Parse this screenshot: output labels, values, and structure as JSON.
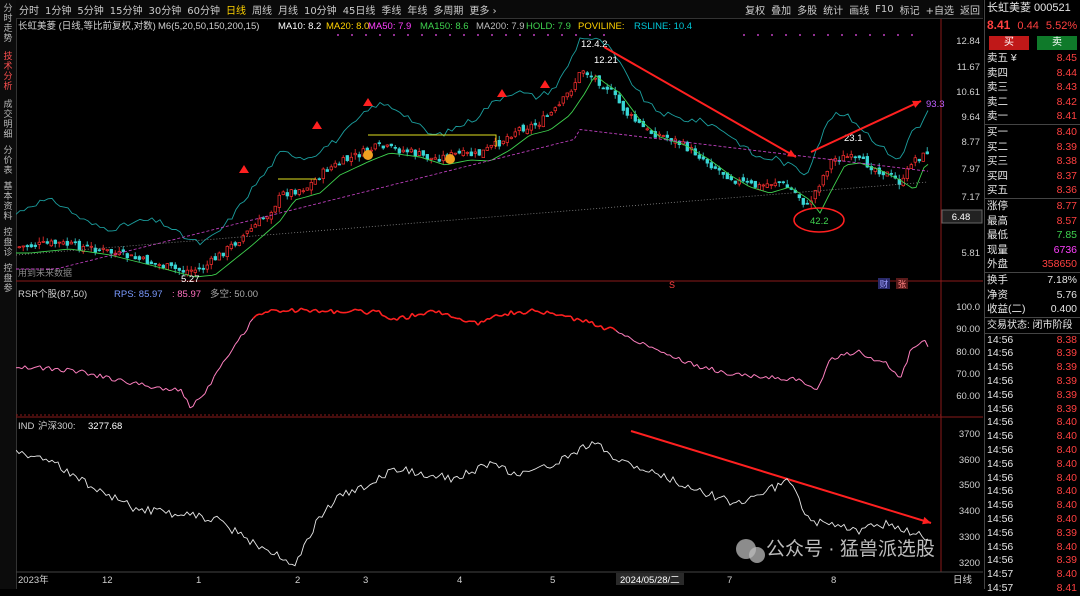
{
  "left_tabs": [
    {
      "label": "分时走势",
      "active": false
    },
    {
      "label": "技术分析",
      "active": true
    },
    {
      "label": "成交明细",
      "active": false
    },
    {
      "label": "分价表",
      "active": false
    },
    {
      "label": "基本资料",
      "active": false
    },
    {
      "label": "控盘诊",
      "active": false
    },
    {
      "label": "控盘参",
      "active": false
    }
  ],
  "toolbar": {
    "periods": [
      "分时",
      "1分钟",
      "5分钟",
      "15分钟",
      "30分钟",
      "60分钟",
      "日线",
      "周线",
      "月线",
      "10分钟",
      "45日线",
      "季线",
      "年线",
      "多周期",
      "更多 ›"
    ],
    "active_period": "日线",
    "actions": [
      "复权",
      "叠加",
      "多股",
      "统计",
      "画线",
      "F10",
      "标记",
      "+自选",
      "返回"
    ]
  },
  "main": {
    "header": "长虹美菱 (日线,等比前复权,对数)",
    "ma_label": "M6(5,20,50,150,200,15)",
    "ma_items": [
      {
        "text": "MA10: 8.2",
        "color": "#ffffff"
      },
      {
        "text": "MA20: 8.0",
        "color": "#ffd200"
      },
      {
        "text": "MA50: 7.9",
        "color": "#ff40ff"
      },
      {
        "text": "MA150: 8.6",
        "color": "#3fd24f"
      },
      {
        "text": "MA200: 7.9",
        "color": "#bbbbbb"
      },
      {
        "text": "HOLD: 7.9",
        "color": "#3fd24f"
      },
      {
        "text": "POVILINE:",
        "color": "#ffd200"
      },
      {
        "text": "RSLINE: 10.4",
        "color": "#00c8d8"
      }
    ],
    "y_ticks": [
      "12.84",
      "11.67",
      "10.61",
      "9.64",
      "8.77",
      "7.97",
      "7.17",
      "6.48",
      "5.81"
    ],
    "current_price_tag": "6.48",
    "note": "用到未来数据",
    "annotations": {
      "low": "5.27",
      "peak": "12.4.2",
      "peak2": "12.21",
      "mid": "23.1",
      "circle": "42.2",
      "arrow_end": "93.3"
    },
    "tags": [
      "S",
      "财",
      "张"
    ]
  },
  "rsr": {
    "header": "RSR个股(87,50)",
    "rps_text": "RPS: 85.97",
    "val_text": ": 85.97",
    "ls_text": "多空: 50.00",
    "y_ticks": [
      "100.0",
      "90.00",
      "80.00",
      "70.00",
      "60.00"
    ]
  },
  "ind": {
    "header": "IND",
    "name": "沪深300:",
    "value": "3277.68",
    "y_ticks": [
      "3700",
      "3600",
      "3500",
      "3400",
      "3300",
      "3200"
    ]
  },
  "x_axis": {
    "labels": [
      "2023年",
      "12",
      "1",
      "2",
      "3",
      "4",
      "5",
      "2024/05/28/二",
      "7",
      "8"
    ],
    "right_label": "日线"
  },
  "watermark": "公众号 · 猛兽派选股",
  "right_panel": {
    "title": "长虹美菱 000521",
    "price": "8.41",
    "change": "0.44",
    "pct": "5.52%",
    "buy_btn": "买",
    "sell_btn": "卖",
    "asks": [
      {
        "label": "卖五 ¥",
        "price": "8.45",
        "vol": ""
      },
      {
        "label": "卖四",
        "price": "8.44",
        "vol": ""
      },
      {
        "label": "卖三",
        "price": "8.43",
        "vol": ""
      },
      {
        "label": "卖二",
        "price": "8.42",
        "vol": ""
      },
      {
        "label": "卖一",
        "price": "8.41",
        "vol": ""
      }
    ],
    "bids": [
      {
        "label": "买一",
        "price": "8.40"
      },
      {
        "label": "买二",
        "price": "8.39"
      },
      {
        "label": "买三",
        "price": "8.38"
      },
      {
        "label": "买四",
        "price": "8.37"
      },
      {
        "label": "买五",
        "price": "8.36"
      }
    ],
    "stats": [
      {
        "label": "涨停",
        "value": "8.77",
        "color": "#ff4040"
      },
      {
        "label": "最高",
        "value": "8.57",
        "color": "#ff4040"
      },
      {
        "label": "最低",
        "value": "7.85",
        "color": "#3fd24f"
      },
      {
        "label": "现量",
        "value": "6736",
        "color": "#ff40ff"
      },
      {
        "label": "外盘",
        "value": "358650",
        "color": "#ff4040"
      }
    ],
    "stats2": [
      {
        "label": "换手",
        "value": "7.18%"
      },
      {
        "label": "净资",
        "value": "5.76"
      },
      {
        "label": "收益(二)",
        "value": "0.400"
      }
    ],
    "trade_status": "交易状态: 闭市阶段",
    "ticks": [
      {
        "time": "14:56",
        "price": "8.38"
      },
      {
        "time": "14:56",
        "price": "8.39"
      },
      {
        "time": "14:56",
        "price": "8.39"
      },
      {
        "time": "14:56",
        "price": "8.39"
      },
      {
        "time": "14:56",
        "price": "8.39"
      },
      {
        "time": "14:56",
        "price": "8.39"
      },
      {
        "time": "14:56",
        "price": "8.40"
      },
      {
        "time": "14:56",
        "price": "8.40"
      },
      {
        "time": "14:56",
        "price": "8.40"
      },
      {
        "time": "14:56",
        "price": "8.40"
      },
      {
        "time": "14:56",
        "price": "8.40"
      },
      {
        "time": "14:56",
        "price": "8.40"
      },
      {
        "time": "14:56",
        "price": "8.40"
      },
      {
        "time": "14:56",
        "price": "8.40"
      },
      {
        "time": "14:56",
        "price": "8.39"
      },
      {
        "time": "14:56",
        "price": "8.40"
      },
      {
        "time": "14:56",
        "price": "8.39"
      },
      {
        "time": "14:57",
        "price": "8.40"
      },
      {
        "time": "14:57",
        "price": "8.41"
      }
    ]
  }
}
